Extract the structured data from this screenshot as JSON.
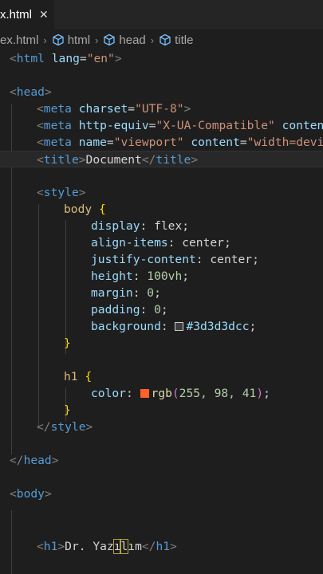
{
  "tab": {
    "label": "x.html",
    "close": "✕"
  },
  "breadcrumb": {
    "file": "ex.html",
    "sep": "›",
    "items": [
      "html",
      "head",
      "title"
    ]
  },
  "code": {
    "html_open": {
      "tag": "html",
      "attr": "lang",
      "value": "\"en\""
    },
    "head_open": "head",
    "meta1": {
      "tag": "meta",
      "attr": "charset",
      "value": "\"UTF-8\""
    },
    "meta2": {
      "tag": "meta",
      "attr": "http-equiv",
      "value": "\"X-UA-Compatible\"",
      "attr2": "content"
    },
    "meta3": {
      "tag": "meta",
      "attr": "name",
      "value": "\"viewport\"",
      "attr2": "content",
      "value2": "\"width=devic"
    },
    "title": {
      "tag": "title",
      "text": "Document"
    },
    "style_open": "style",
    "body_selector": "body",
    "body_rules": [
      {
        "prop": "display",
        "value": "flex"
      },
      {
        "prop": "align-items",
        "value": "center"
      },
      {
        "prop": "justify-content",
        "value": "center"
      },
      {
        "prop": "height",
        "value": "100vh"
      },
      {
        "prop": "margin",
        "value": "0"
      },
      {
        "prop": "padding",
        "value": "0"
      },
      {
        "prop": "background",
        "value": "#3d3d3dcc",
        "swatch": "#3d3d3d"
      }
    ],
    "h1_selector": "h1",
    "h1_rule": {
      "prop": "color",
      "value_fn": "rgb",
      "args": "255, 98, 41",
      "swatch": "#ff6229"
    },
    "style_close": "style",
    "head_close": "head",
    "body_open": "body",
    "h1_line": {
      "tag": "h1",
      "text_a": "Dr. Yaz",
      "text_b": "ı",
      "text_c": "l",
      "text_d": "ım"
    }
  }
}
